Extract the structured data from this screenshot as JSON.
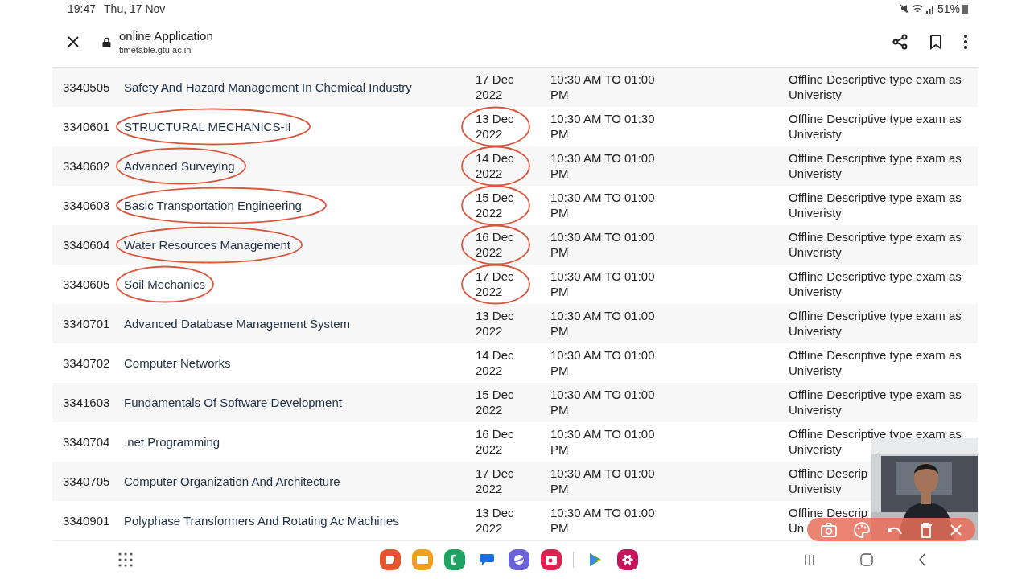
{
  "status_bar": {
    "time": "19:47",
    "date": "Thu, 17 Nov",
    "battery": "51%"
  },
  "header": {
    "title": "online Application",
    "url": "timetable.gtu.ac.in"
  },
  "table": {
    "rows": [
      {
        "code": "3340505",
        "name": "Safety And Hazard Management In Chemical Industry",
        "date": "17 Dec 2022",
        "time": "10:30 AM TO 01:00 PM",
        "note": [
          "Offline Descriptive type exam as",
          "Univeristy"
        ]
      },
      {
        "code": "3340601",
        "name": "STRUCTURAL MECHANICS-II",
        "date": "13 Dec 2022",
        "time": "10:30 AM TO 01:30 PM",
        "note": [
          "Offline Descriptive type exam as",
          "Univeristy"
        ]
      },
      {
        "code": "3340602",
        "name": "Advanced Surveying",
        "date": "14 Dec 2022",
        "time": "10:30 AM TO 01:00 PM",
        "note": [
          "Offline Descriptive type exam as",
          "Univeristy"
        ]
      },
      {
        "code": "3340603",
        "name": "Basic Transportation Engineering",
        "date": "15 Dec 2022",
        "time": "10:30 AM TO 01:00 PM",
        "note": [
          "Offline Descriptive type exam as",
          "Univeristy"
        ]
      },
      {
        "code": "3340604",
        "name": "Water Resources Management",
        "date": "16 Dec 2022",
        "time": "10:30 AM TO 01:00 PM",
        "note": [
          "Offline Descriptive type exam as",
          "Univeristy"
        ]
      },
      {
        "code": "3340605",
        "name": "Soil Mechanics",
        "date": "17 Dec 2022",
        "time": "10:30 AM TO 01:00 PM",
        "note": [
          "Offline Descriptive type exam as",
          "Univeristy"
        ]
      },
      {
        "code": "3340701",
        "name": "Advanced Database Management System",
        "date": "13 Dec 2022",
        "time": "10:30 AM TO 01:00 PM",
        "note": [
          "Offline Descriptive type exam as",
          "Univeristy"
        ]
      },
      {
        "code": "3340702",
        "name": "Computer Networks",
        "date": "14 Dec 2022",
        "time": "10:30 AM TO 01:00 PM",
        "note": [
          "Offline Descriptive type exam as",
          "Univeristy"
        ]
      },
      {
        "code": "3341603",
        "name": "Fundamentals Of Software Development",
        "date": "15 Dec 2022",
        "time": "10:30 AM TO 01:00 PM",
        "note": [
          "Offline Descriptive type exam as",
          "Univeristy"
        ]
      },
      {
        "code": "3340704",
        "name": ".net Programming",
        "date": "16 Dec 2022",
        "time": "10:30 AM TO 01:00 PM",
        "note": [
          "Offline Descriptive type exam as",
          "Univeristy"
        ]
      },
      {
        "code": "3340705",
        "name": "Computer Organization And Architecture",
        "date": "17 Dec 2022",
        "time": "10:30 AM TO 01:00 PM",
        "note": [
          "Offline Descrip",
          "Univeristy"
        ]
      },
      {
        "code": "3340901",
        "name": "Polyphase Transformers And Rotating Ac Machines",
        "date": "13 Dec 2022",
        "time": "10:30 AM TO 01:00 PM",
        "note": [
          "Offline Descrip",
          "Un"
        ]
      }
    ]
  }
}
